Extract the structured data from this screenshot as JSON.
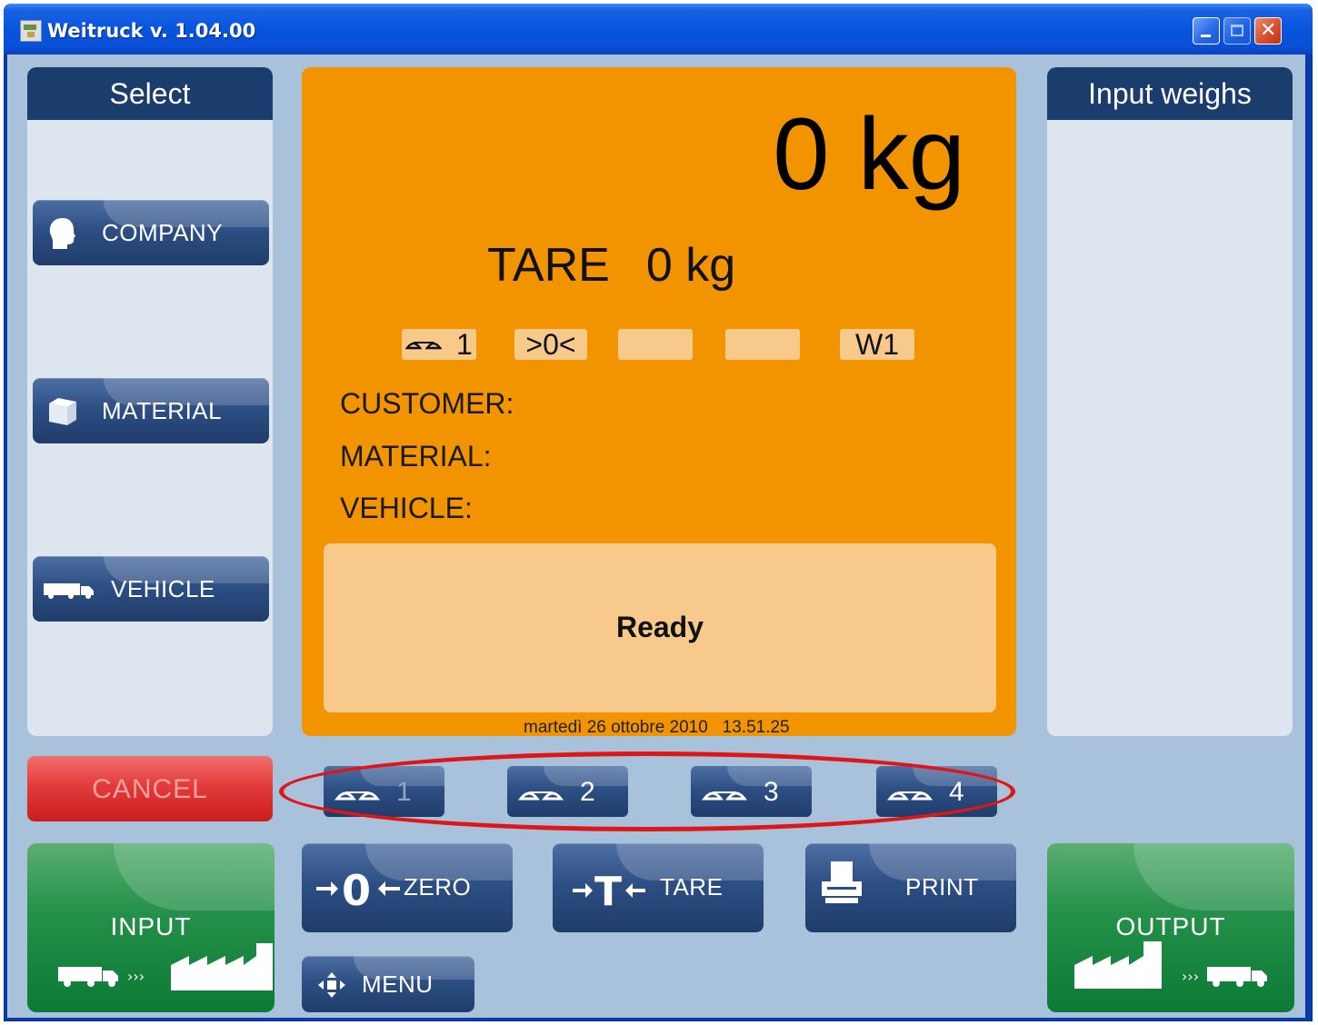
{
  "window": {
    "title": "Weitruck v. 1.04.00"
  },
  "left_panel": {
    "header": "Select",
    "buttons": [
      {
        "label": "COMPANY",
        "icon": "company-icon"
      },
      {
        "label": "MATERIAL",
        "icon": "box-icon"
      },
      {
        "label": "VEHICLE",
        "icon": "truck-icon"
      }
    ]
  },
  "right_panel": {
    "header": "Input weighs"
  },
  "display": {
    "weight": "0 kg",
    "tare_label": "TARE",
    "tare_value": "0 kg",
    "indicators": [
      "1",
      ">0<",
      "",
      "",
      "W1"
    ],
    "customer_label": "CUSTOMER:",
    "material_label": "MATERIAL:",
    "vehicle_label": "VEHICLE:",
    "message": "Ready",
    "date": "martedì 26 ottobre 2010",
    "time": "13.51.25"
  },
  "scales": [
    "1",
    "2",
    "3",
    "4"
  ],
  "actions": {
    "cancel": "CANCEL",
    "input": "INPUT",
    "output": "OUTPUT",
    "zero": "ZERO",
    "tare": "TARE",
    "print": "PRINT",
    "menu": "MENU"
  },
  "colors": {
    "display_bg": "#f29400",
    "panel_header": "#1a3d6e",
    "highlight_ellipse": "#e01515"
  }
}
